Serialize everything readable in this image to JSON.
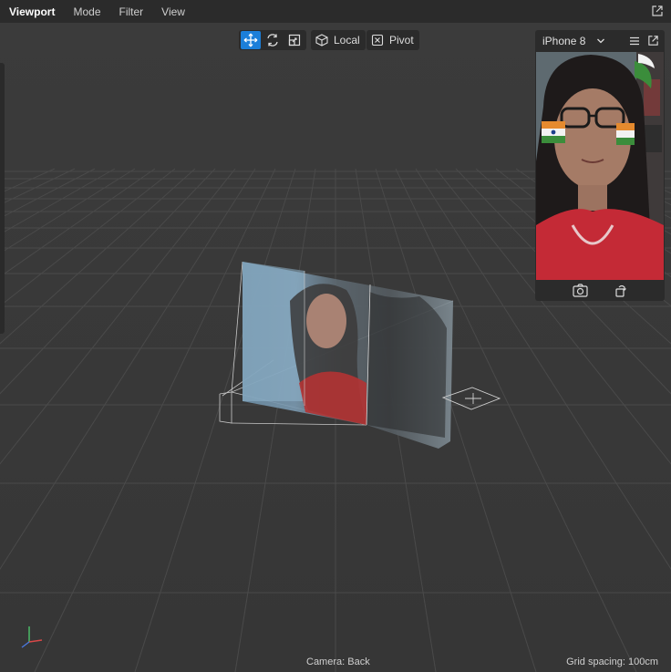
{
  "menubar": {
    "items": [
      "Viewport",
      "Mode",
      "Filter",
      "View"
    ],
    "active_index": 0
  },
  "toolbar": {
    "transform_tools": [
      "move-icon",
      "rotate-icon",
      "scale-icon"
    ],
    "active_tool": "move-icon",
    "space_label": "Local",
    "pivot_label": "Pivot"
  },
  "device_preview": {
    "device_name": "iPhone 8",
    "footer_actions": [
      "capture-icon",
      "rotate-device-icon"
    ]
  },
  "status": {
    "camera": "Camera: Back",
    "grid_spacing": "Grid spacing: 100cm"
  },
  "colors": {
    "accent": "#1c7fd9",
    "background": "#3a3a3a",
    "panel": "#2b2b2b"
  }
}
